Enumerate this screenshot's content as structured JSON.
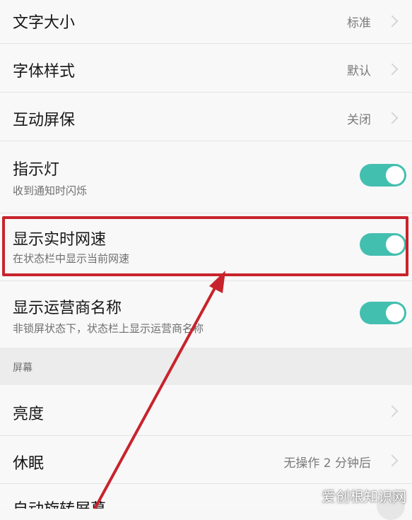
{
  "settings": {
    "text_size": {
      "label": "文字大小",
      "value": "标准"
    },
    "font_style": {
      "label": "字体样式",
      "value": "默认"
    },
    "interactive_screensaver": {
      "label": "互动屏保",
      "value": "关闭"
    },
    "indicator_light": {
      "label": "指示灯",
      "subtitle": "收到通知时闪烁",
      "enabled": true
    },
    "realtime_speed": {
      "label": "显示实时网速",
      "subtitle": "在状态栏中显示当前网速",
      "enabled": true
    },
    "carrier_name": {
      "label": "显示运营商名称",
      "subtitle": "非锁屏状态下，状态栏上显示运营商名称",
      "enabled": true
    }
  },
  "screen_section": {
    "header": "屏幕",
    "brightness": {
      "label": "亮度"
    },
    "sleep": {
      "label": "休眠",
      "value": "无操作 2 分钟后"
    },
    "auto_rotate": {
      "label": "自动旋转屏幕"
    }
  },
  "watermark": "爱创根知识网",
  "colors": {
    "toggle_on": "#43bfb0",
    "highlight": "#c8232c"
  }
}
